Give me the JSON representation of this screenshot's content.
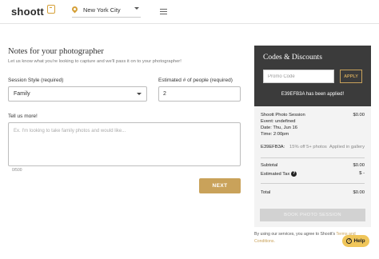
{
  "header": {
    "logo": "shoott",
    "location": "New York City"
  },
  "form": {
    "title": "Notes for your photographer",
    "subtitle": "Let us know what you're looking to capture and we'll pass it on to your photographer!",
    "session_style_label": "Session Style (required)",
    "session_style_value": "Family",
    "people_label": "Estimated # of people (required)",
    "people_value": "2",
    "tell_us_label": "Tell us more!",
    "tell_us_placeholder": "Ex. I'm looking to take family photos and would like...",
    "char_count": "0/500",
    "next_label": "NEXT"
  },
  "codes": {
    "title": "Codes & Discounts",
    "promo_placeholder": "Promo Code",
    "apply_label": "APPLY",
    "applied_message": "E39EFB3A has been applied!"
  },
  "summary": {
    "session_name": "Shoott Photo Session",
    "session_price": "$0.00",
    "event": "Event: undefined",
    "date": "Date: Thu, Jun 16",
    "time": "Time: 2:00pm",
    "discount_code": "E39EFB3A:",
    "discount_desc": "15% off 5+ photos",
    "discount_status": "Applied in gallery",
    "subtotal_label": "Subtotal",
    "subtotal_value": "$0.00",
    "tax_label": "Estimated Tax",
    "tax_value": "$ -",
    "total_label": "Total",
    "total_value": "$0.00",
    "book_label": "BOOK PHOTO SESSION"
  },
  "terms": {
    "text": "By using our services, you agree to Shoott's",
    "link": "Terms and Conditions."
  },
  "help": {
    "label": "Help"
  },
  "colors": {
    "accent": "#c9a25a",
    "dark_panel": "#3b3b3b",
    "help_bg": "#f0c65a"
  }
}
